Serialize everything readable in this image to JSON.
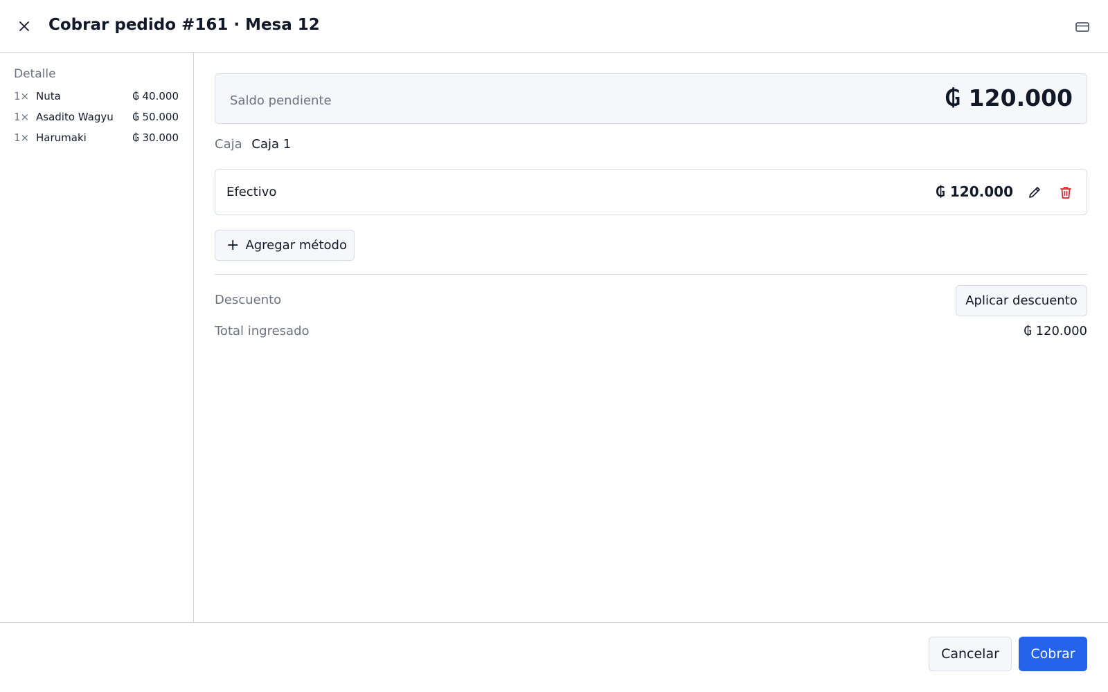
{
  "header": {
    "title": "Cobrar pedido #161 · Mesa 12"
  },
  "sidebar": {
    "title": "Detalle",
    "items": [
      {
        "qty": "1×",
        "name": "Nuta",
        "price": "₲ 40.000"
      },
      {
        "qty": "1×",
        "name": "Asadito Wagyu",
        "price": "₲ 50.000"
      },
      {
        "qty": "1×",
        "name": "Harumaki",
        "price": "₲ 30.000"
      }
    ]
  },
  "main": {
    "balance_label": "Saldo pendiente",
    "balance_value": "₲ 120.000",
    "caja_label": "Caja",
    "caja_value": "Caja 1",
    "payment_methods": [
      {
        "name": "Efectivo",
        "amount": "₲ 120.000"
      }
    ],
    "add_method_label": "Agregar método",
    "discount_label": "Descuento",
    "apply_discount_label": "Aplicar descuento",
    "total_label": "Total ingresado",
    "total_value": "₲ 120.000"
  },
  "footer": {
    "cancel_label": "Cancelar",
    "pay_label": "Cobrar"
  },
  "icons": {
    "close": "close-icon",
    "card": "credit-card-icon",
    "edit": "pencil-icon",
    "delete": "trash-icon",
    "add": "plus-icon"
  },
  "colors": {
    "primary": "#2563eb",
    "danger": "#dc2626",
    "muted_text": "#6b7280",
    "panel_bg": "#f6f7fa"
  }
}
